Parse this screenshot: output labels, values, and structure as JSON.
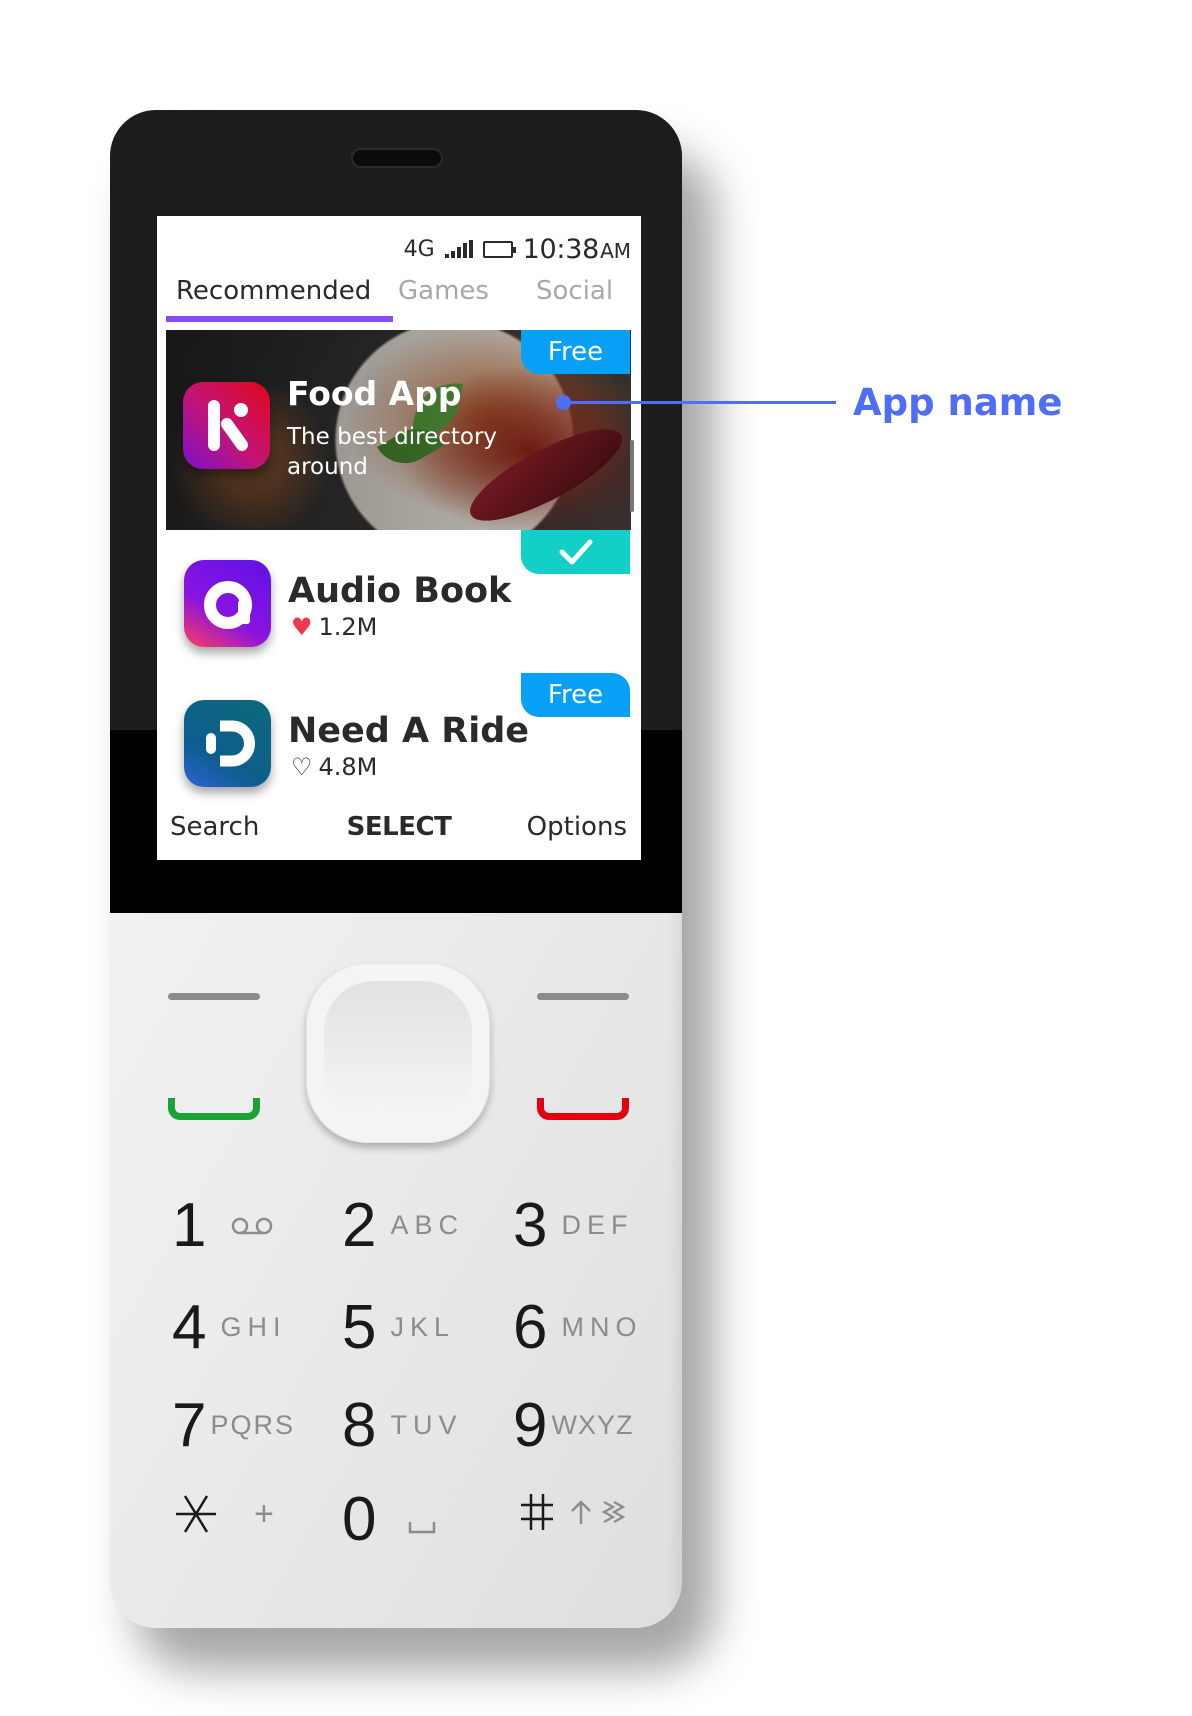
{
  "status_bar": {
    "network": "4G",
    "signal_icon": "signal-bars-icon",
    "battery_icon": "battery-full-icon",
    "time": "10:38",
    "ampm": "AM"
  },
  "tabs": [
    {
      "label": "Recommended",
      "active": true
    },
    {
      "label": "Games",
      "active": false
    },
    {
      "label": "Social",
      "active": false
    }
  ],
  "featured": {
    "title": "Food App",
    "subtitle": "The best directory around",
    "tag": "Free",
    "icon": "food-app-k-logo-icon"
  },
  "apps": [
    {
      "name": "Audio Book",
      "likes": "1.2M",
      "liked": true,
      "tag": "installed-check",
      "icon": "audio-book-logo-icon"
    },
    {
      "name": "Need A Ride",
      "likes": "4.8M",
      "liked": false,
      "tag": "Free",
      "icon": "need-a-ride-logo-icon"
    }
  ],
  "softkeys": {
    "left": "Search",
    "center": "SELECT",
    "right": "Options"
  },
  "keypad": [
    {
      "digit": "1",
      "letters": ""
    },
    {
      "digit": "2",
      "letters": "ABC"
    },
    {
      "digit": "3",
      "letters": "DEF"
    },
    {
      "digit": "4",
      "letters": "GHI"
    },
    {
      "digit": "5",
      "letters": "JKL"
    },
    {
      "digit": "6",
      "letters": "MNO"
    },
    {
      "digit": "7",
      "letters": "PQRS"
    },
    {
      "digit": "8",
      "letters": "TUV"
    },
    {
      "digit": "9",
      "letters": "WXYZ"
    },
    {
      "digit": "*",
      "letters": "+"
    },
    {
      "digit": "0",
      "letters": ""
    },
    {
      "digit": "#",
      "letters": ""
    }
  ],
  "annotation": {
    "label": "App name",
    "color": "#4F6EF7"
  },
  "colors": {
    "tab_accent": "#8A4BFF",
    "free_tag": "#08A0F7",
    "check_tag": "#12CFC7",
    "call_green": "#1AA335",
    "end_red": "#E4000F",
    "heart": "#F1364F"
  }
}
